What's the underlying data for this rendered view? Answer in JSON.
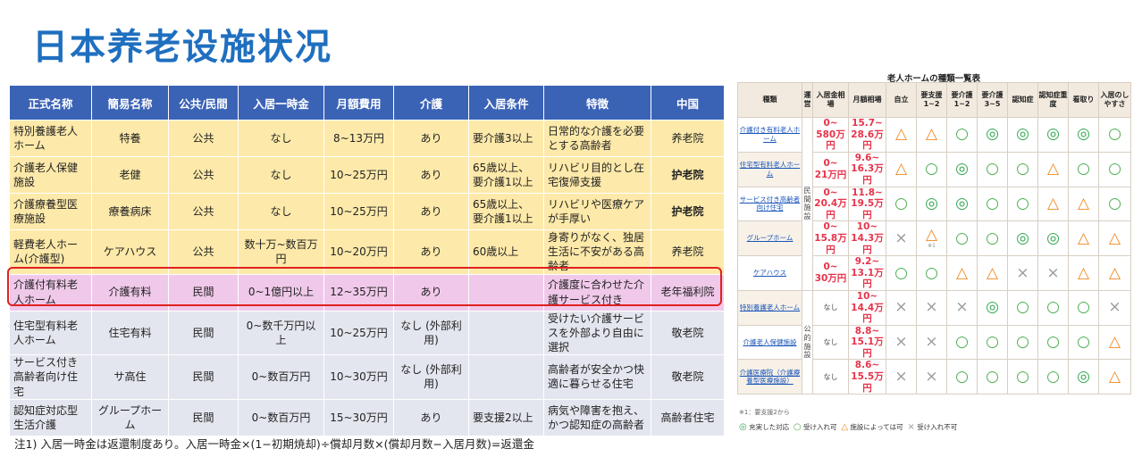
{
  "title": "日本养老设施状况",
  "main_table": {
    "headers": [
      "正式名称",
      "簡易名称",
      "公共/民間",
      "入居一時金",
      "月額費用",
      "介護",
      "入居条件",
      "特徴",
      "中国"
    ],
    "rows": [
      {
        "cells": [
          "特別養護老人ホーム",
          "特養",
          "公共",
          "なし",
          "8~13万円",
          "あり",
          "要介護3以上",
          "日常的な介護を必要とする高齢者",
          "养老院"
        ],
        "color": "yellow"
      },
      {
        "cells": [
          "介護老人保健施設",
          "老健",
          "公共",
          "なし",
          "10~25万円",
          "あり",
          "65歳以上、要介護1以上",
          "リハビリ目的とし在宅復帰支援",
          "护老院"
        ],
        "color": "yellow"
      },
      {
        "cells": [
          "介護療養型医療施設",
          "療養病床",
          "公共",
          "なし",
          "10~25万円",
          "あり",
          "65歳以上、要介護1以上",
          "リハビリや医療ケアが手厚い",
          "护老院"
        ],
        "color": "yellow"
      },
      {
        "cells": [
          "軽費老人ホーム(介護型)",
          "ケアハウス",
          "公共",
          "数十万~数百万円",
          "10~20万円",
          "あり",
          "60歳以上",
          "身寄りがなく、独居生活に不安がある高齢者",
          "养老院"
        ],
        "color": "yellow"
      },
      {
        "cells": [
          "介護付有料老人ホーム",
          "介護有料",
          "民間",
          "0~1億円以上",
          "12~35万円",
          "あり",
          "",
          "介護度に合わせた介護サービス付き",
          "老年福利院"
        ],
        "color": "pink"
      },
      {
        "cells": [
          "住宅型有料老人ホーム",
          "住宅有料",
          "民間",
          "0~数千万円以上",
          "10~25万円",
          "なし (外部利用)",
          "",
          "受けたい介護サービスを外部より自由に選択",
          "敬老院"
        ],
        "color": "gray"
      },
      {
        "cells": [
          "サービス付き高齢者向け住宅",
          "サ高住",
          "民間",
          "0~数百万円",
          "10~30万円",
          "なし (外部利用)",
          "",
          "高齢者が安全かつ快適に暮らせる住宅",
          "敬老院"
        ],
        "color": "gray"
      },
      {
        "cells": [
          "認知症対応型生活介護",
          "グループホーム",
          "民間",
          "0~数百万円",
          "15~30万円",
          "あり",
          "要支援2以上",
          "病気や障害を抱え、かつ認知症の高齢者",
          "高齢者住宅"
        ],
        "color": "gray"
      }
    ],
    "footnote": "注1) 入居一時金は返還制度あり。入居一時金×(1−初期焼却)÷償却月数×(償却月数−入居月数)=返還金"
  },
  "side_table": {
    "title": "老人ホームの種類一覧表",
    "headers": [
      "種類",
      "運営",
      "入居金相場",
      "月額相場",
      "自立",
      "要支援1~2",
      "要介護1~2",
      "要介護3~5",
      "認知症",
      "認知症重度",
      "看取り",
      "入居のしやすさ"
    ],
    "groups": {
      "private": "民間施設",
      "public": "公的施設"
    },
    "rows": [
      {
        "name": "介護付き有料老人ホーム",
        "entry": "0~",
        "entry2": "580万円",
        "monthly": "15.7~",
        "monthly2": "28.6万円",
        "marks": [
          "t",
          "t",
          "c",
          "dc",
          "dc",
          "dc",
          "dc",
          "c"
        ],
        "note": ""
      },
      {
        "name": "住宅型有料老人ホーム",
        "entry": "0~",
        "entry2": "21万円",
        "monthly": "9.6~",
        "monthly2": "16.3万円",
        "marks": [
          "t",
          "c",
          "dc",
          "c",
          "c",
          "t",
          "c",
          "c"
        ],
        "note": ""
      },
      {
        "name": "サービス付き高齢者向け住宅",
        "entry": "0~",
        "entry2": "20.4万円",
        "monthly": "11.8~",
        "monthly2": "19.5万円",
        "marks": [
          "c",
          "dc",
          "dc",
          "c",
          "c",
          "t",
          "t",
          "c"
        ],
        "note": ""
      },
      {
        "name": "グループホーム",
        "entry": "0~",
        "entry2": "15.8万円",
        "monthly": "10~",
        "monthly2": "14.3万円",
        "marks": [
          "x",
          "t",
          "c",
          "c",
          "dc",
          "dc",
          "t",
          "t"
        ],
        "note": "※1"
      },
      {
        "name": "ケアハウス",
        "entry": "0~",
        "entry2": "30万円",
        "monthly": "9.2~",
        "monthly2": "13.1万円",
        "marks": [
          "c",
          "c",
          "t",
          "t",
          "x",
          "x",
          "t",
          " "
        ],
        "note": ""
      },
      {
        "name": "特別養護老人ホーム",
        "entry": "なし",
        "entry2": "",
        "monthly": "10~",
        "monthly2": "14.4万円",
        "marks": [
          "x",
          "x",
          "x",
          "dc",
          "c",
          "c",
          "c",
          "x"
        ],
        "note": ""
      },
      {
        "name": "介護老人保健施設",
        "entry": "なし",
        "entry2": "",
        "monthly": "8.8~",
        "monthly2": "15.1万円",
        "marks": [
          "x",
          "x",
          "c",
          "c",
          "c",
          "c",
          "c",
          "t"
        ],
        "note": ""
      },
      {
        "name": "介護医療院（介護療養型医療施設）",
        "entry": "なし",
        "entry2": "",
        "monthly": "8.6~",
        "monthly2": "15.5万円",
        "marks": [
          "x",
          "x",
          "c",
          "c",
          "c",
          "c",
          "dc",
          "t"
        ],
        "note": ""
      }
    ],
    "note": "※1：要支援2から",
    "legend": {
      "dc": "充実した対応",
      "c": "受け入れ可",
      "t": "施設によっては可",
      "x": "受け入れ不可"
    },
    "symbols": {
      "dc": "◎",
      "c": "○",
      "t": "△",
      "x": "×"
    }
  }
}
